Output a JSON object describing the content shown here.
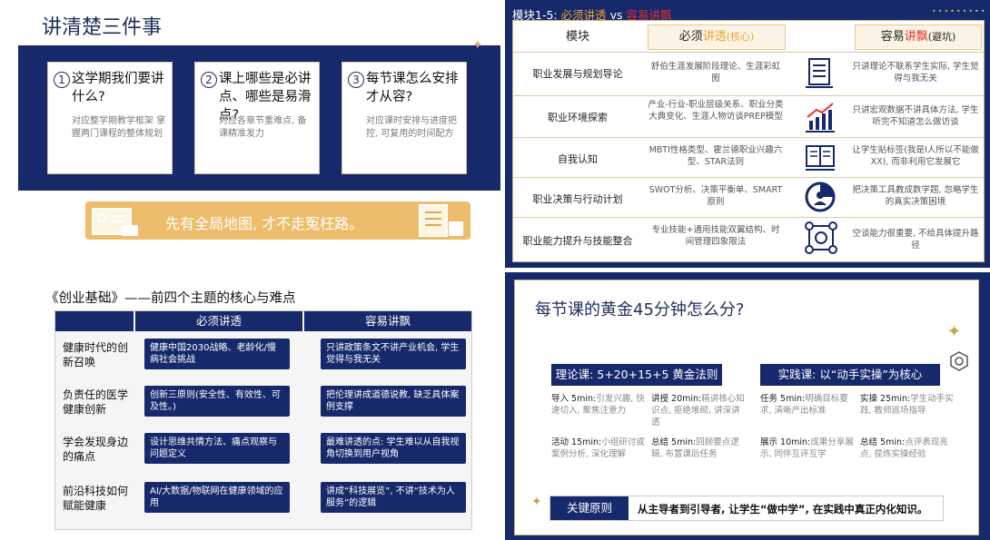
{
  "colors": {
    "navy": "#16296b",
    "gold": "#ebbd6c",
    "orange": "#e8a636",
    "red": "#e2302a"
  },
  "p1": {
    "title": "讲清楚三件事",
    "cards": [
      {
        "num": "1",
        "head": "这学期我们要讲什么?",
        "sub": "对应整学期教学框架 掌握两门课程的整体规划"
      },
      {
        "num": "2",
        "head": "课上哪些是必讲点、哪些是易滑点?",
        "sub": "对应各章节重难点, 备课精准发力"
      },
      {
        "num": "3",
        "head": "每节课怎么安排才从容?",
        "sub": "对应课时安排与进度把控, 可复用的时间配方"
      }
    ],
    "banner": "先有全局地图, 才不走冤枉路。"
  },
  "p2": {
    "prefix": "模块1-5: ",
    "must_label": "必须讲透",
    "vs": "vs",
    "easy_label": "容易讲飘",
    "headers": {
      "module": "模块",
      "must_a": "必须",
      "must_b": "讲透",
      "must_c": "(核心)",
      "easy_a": "容易",
      "easy_b": "讲飘",
      "easy_c": "(避坑)"
    },
    "rows": [
      {
        "module": "职业发展与规划导论",
        "must": "舒伯生涯发展阶段理论、生涯彩虹图",
        "icon": "document-icon",
        "easy": "只讲理论不联系学生实际, 学生觉得与我无关"
      },
      {
        "module": "职业环境探索",
        "must": "产业-行业-职业层级关系、职业分类大典变化、生涯人物访谈PREP模型",
        "icon": "growth-chart-icon",
        "easy": "只讲宏观数据不讲具体方法, 学生听完不知道怎么做访谈"
      },
      {
        "module": "自我认知",
        "must": "MBTI性格类型、霍兰德职业兴趣六型、STAR法则",
        "icon": "book-icon",
        "easy": "让学生贴标签(我是I人所以不能做XX), 而非利用它发展它"
      },
      {
        "module": "职业决策与行动计划",
        "must": "SWOT分析、决策平衡单、SMART原则",
        "icon": "pie-person-icon",
        "easy": "把决策工具教成数学题, 忽略学生的真实决策困境"
      },
      {
        "module": "职业能力提升与技能整合",
        "must": "专业技能+通用技能双翼结构、时间管理四象限法",
        "icon": "network-icon",
        "easy": "空谈能力很重要, 不给具体提升路径"
      }
    ]
  },
  "p3": {
    "title": "《创业基础》——前四个主题的核心与难点",
    "headers": {
      "must": "必须讲透",
      "easy": "容易讲飘"
    },
    "rows": [
      {
        "topic": "健康时代的创新召唤",
        "must": "健康中国2030战略、老龄化/慢病社会挑战",
        "easy": "只讲政策条文不讲产业机会, 学生觉得与我无关"
      },
      {
        "topic": "负责任的医学健康创新",
        "must": "创新三原则(安全性、有效性、可及性。)",
        "easy": "把伦理讲成道德说教, 缺乏具体案例支撑"
      },
      {
        "topic": "学会发现身边的痛点",
        "must": "设计思维共情方法、痛点观察与问题定义",
        "easy": "最难讲透的点: 学生难以从自我视角切换到用户视角"
      },
      {
        "topic": "前沿科技如何赋能健康",
        "must": "AI/大数据/物联网在健康领域的应用",
        "easy": "讲成“科技展览”, 不讲“技术为人服务”的逻辑"
      }
    ]
  },
  "p4": {
    "title": "每节课的黄金45分钟怎么分?",
    "theory_title": "理论课: 5+20+15+5 黄金法则",
    "practice_title": "实践课: 以“动手实操”为核心",
    "theory_items": [
      {
        "head": "导入 5min:",
        "body": "引发兴趣, 快速切入, 聚焦注意力"
      },
      {
        "head": "讲授 20min:",
        "body": "精讲核心知识点, 拒绝堆砌, 讲深讲透"
      },
      {
        "head": "活动 15min:",
        "body": "小组研讨或案例分析, 深化理解"
      },
      {
        "head": "总结 5min:",
        "body": "回顾要点逻辑, 布置课后任务"
      }
    ],
    "practice_items": [
      {
        "head": "任务 5min:",
        "body": "明确目标要求, 清晰产出标准"
      },
      {
        "head": "实操 25min:",
        "body": "学生动手实践, 教师巡场指导"
      },
      {
        "head": "展示 10min:",
        "body": "成果分享展示, 同伴互评互学"
      },
      {
        "head": "总结 5min:",
        "body": "点评表现亮点, 提炼实操经验"
      }
    ],
    "key_label": "关键原则",
    "key_text": "从主导者到引导者, 让学生“做中学”, 在实践中真正内化知识。"
  }
}
